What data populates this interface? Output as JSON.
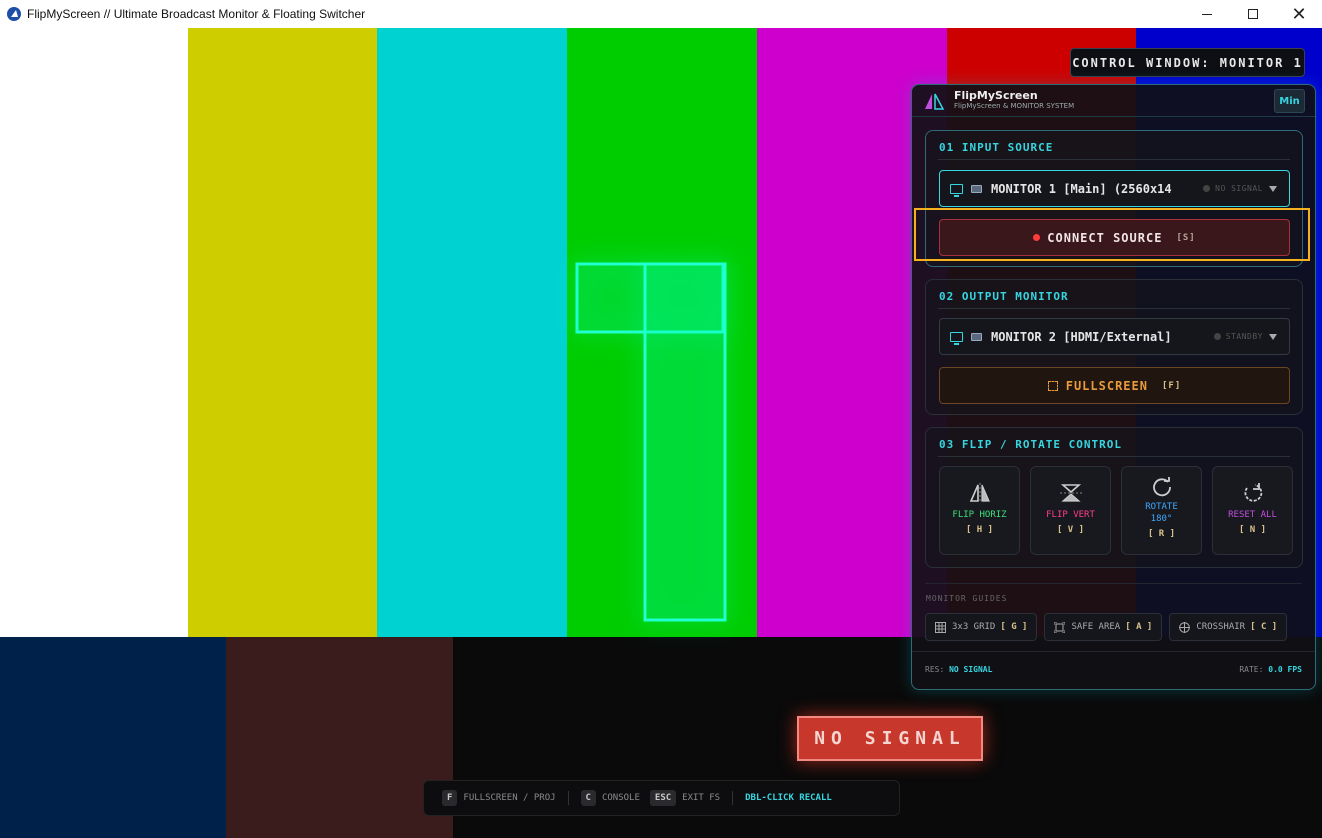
{
  "window": {
    "title": "FlipMyScreen // Ultimate Broadcast Monitor & Floating Switcher",
    "controls": {
      "minimize": "minimize-icon",
      "maximize": "maximize-icon",
      "close": "✕"
    }
  },
  "test_pattern": {
    "top_colors": [
      "#ffffff",
      "#cdcd00",
      "#00d2d2",
      "#00cd00",
      "#cd00cd",
      "#cd0000",
      "#0000cd"
    ],
    "bottom_colors": [
      "#00224a",
      "#3a1c1c",
      "#0a0a0a",
      "#0a0a0a",
      "#0a0a0a",
      "#0a0a0a"
    ]
  },
  "overlay": {
    "no_signal": "NO SIGNAL",
    "control_window_label": "CONTROL WINDOW: MONITOR 1"
  },
  "hints": {
    "f_key": "F",
    "f_label": "FULLSCREEN / PROJ",
    "c_key": "C",
    "c_label": "CONSOLE",
    "esc_key": "ESC",
    "esc_label": "EXIT FS",
    "dbl_label": "DBL-CLICK RECALL"
  },
  "panel": {
    "brand_name": "FlipMyScreen",
    "brand_sub": "FlipMyScreen & MONITOR SYSTEM",
    "min_label": "Min",
    "input": {
      "title": "01 INPUT SOURCE",
      "value": "MONITOR 1 [Main] (2560x14",
      "status": "NO SIGNAL",
      "connect_label": "CONNECT SOURCE",
      "connect_key": "[S]"
    },
    "output": {
      "title": "02 OUTPUT MONITOR",
      "value": "MONITOR 2 [HDMI/External]",
      "status": "STANDBY",
      "fullscreen_label": "FULLSCREEN",
      "fullscreen_key": "[F]"
    },
    "flip": {
      "title": "03 FLIP / ROTATE CONTROL",
      "buttons": [
        {
          "label": "FLIP HORIZ",
          "key": "[ H ]",
          "color": "#3ee07a",
          "icon": "flip-horizontal-icon"
        },
        {
          "label": "FLIP VERT",
          "key": "[ V ]",
          "color": "#ff3e88",
          "icon": "flip-vertical-icon"
        },
        {
          "label": "ROTATE 180°",
          "key": "[ R ]",
          "color": "#3ea8ff",
          "icon": "rotate-icon"
        },
        {
          "label": "RESET ALL",
          "key": "[ N ]",
          "color": "#c24ee0",
          "icon": "reset-icon"
        }
      ]
    },
    "guides": {
      "title": "MONITOR GUIDES",
      "items": [
        {
          "label": "3x3 GRID",
          "key": "[ G ]",
          "icon": "grid-icon"
        },
        {
          "label": "SAFE AREA",
          "key": "[ A ]",
          "icon": "safe-area-icon"
        },
        {
          "label": "CROSSHAIR",
          "key": "[ C ]",
          "icon": "crosshair-icon"
        }
      ]
    },
    "footer": {
      "res_label": "RES:",
      "res_value": "NO SIGNAL",
      "rate_label": "RATE:",
      "rate_value": "0.0 FPS"
    }
  }
}
